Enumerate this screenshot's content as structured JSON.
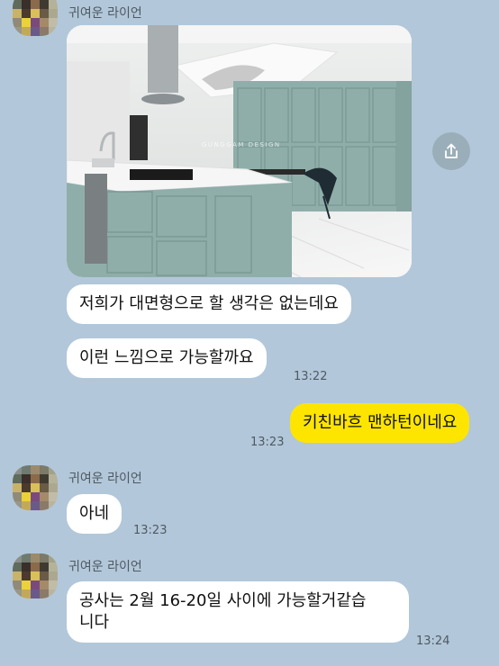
{
  "messages": [
    {
      "sender": "귀여운 라이언"
    },
    {
      "text": "저희가 대면형으로 할 생각은 없는데요"
    },
    {
      "text": "이런 느낌으로 가능할까요",
      "time": "13:22"
    },
    {
      "text": "키친바흐 맨하턴이네요",
      "time": "13:23"
    },
    {
      "sender": "귀여운 라이언",
      "text": "아네",
      "time": "13:23"
    },
    {
      "sender": "귀여운 라이언",
      "text_line1": "공사는 2월 16-20일 사이에 가능할거같습",
      "text_line2": "니다",
      "time": "13:24"
    }
  ],
  "photo": {
    "watermark": "GUNGGAM DESIGN"
  },
  "icons": {
    "share": "share-icon"
  },
  "colors": {
    "background": "#b2c7d9",
    "my_bubble": "#fee500",
    "other_bubble": "#ffffff",
    "cabinet": "#8faeaa"
  }
}
